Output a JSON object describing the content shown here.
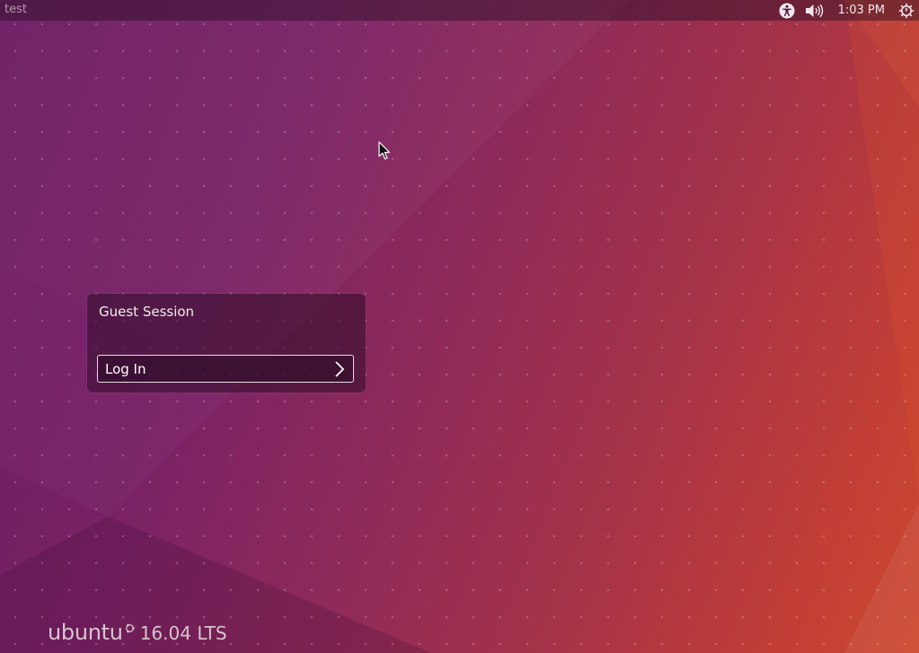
{
  "topbar": {
    "hostname": "test",
    "clock": "1:03 PM",
    "indicators": {
      "accessibility_icon": "accessibility-icon",
      "sound_icon": "sound-icon",
      "power_icon": "power-icon"
    }
  },
  "login": {
    "user_name": "Guest Session",
    "button_label": "Log In",
    "button_icon": "chevron-right-icon"
  },
  "branding": {
    "wordmark": "ubuntu",
    "version": "16.04 LTS",
    "logo_icon": "circle-of-friends-icon"
  },
  "colors": {
    "panel_text": "#f2e6ee",
    "accent_orange": "#cc4a2e",
    "aubergine": "#6b1d63"
  }
}
